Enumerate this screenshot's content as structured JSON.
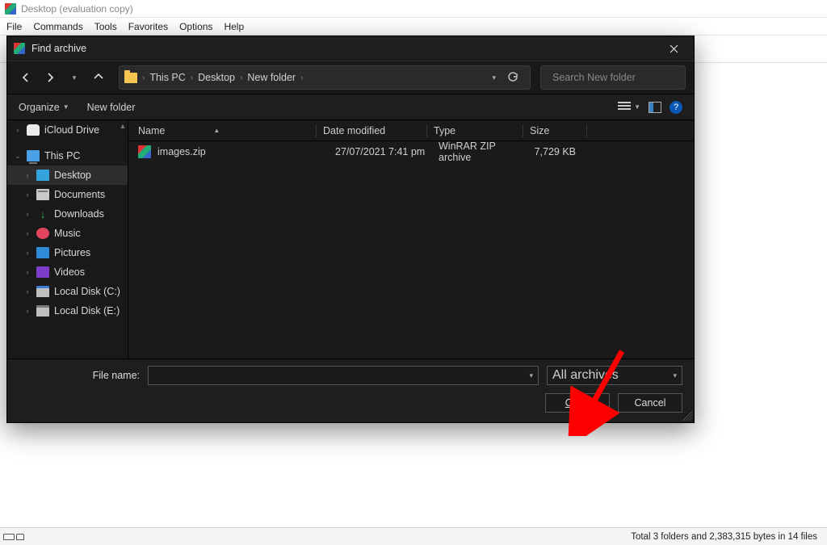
{
  "winrar": {
    "title": "Desktop (evaluation copy)",
    "menu": [
      "File",
      "Commands",
      "Tools",
      "Favorites",
      "Options",
      "Help"
    ],
    "status": "Total 3 folders and 2,383,315 bytes in 14 files"
  },
  "dialog": {
    "title": "Find archive",
    "breadcrumb": [
      "This PC",
      "Desktop",
      "New folder"
    ],
    "search_placeholder": "Search New folder",
    "toolbar": {
      "organize": "Organize",
      "newfolder": "New folder"
    },
    "tree": {
      "cloud": "iCloud Drive",
      "pc": "This PC",
      "desktop": "Desktop",
      "documents": "Documents",
      "downloads": "Downloads",
      "music": "Music",
      "pictures": "Pictures",
      "videos": "Videos",
      "diskC": "Local Disk (C:)",
      "diskE": "Local Disk (E:)"
    },
    "columns": {
      "name": "Name",
      "date": "Date modified",
      "type": "Type",
      "size": "Size"
    },
    "files": [
      {
        "name": "images.zip",
        "date": "27/07/2021 7:41 pm",
        "type": "WinRAR ZIP archive",
        "size": "7,729 KB"
      }
    ],
    "footer": {
      "filename_label": "File name:",
      "filter": "All archives",
      "open": "Open",
      "cancel": "Cancel"
    }
  }
}
